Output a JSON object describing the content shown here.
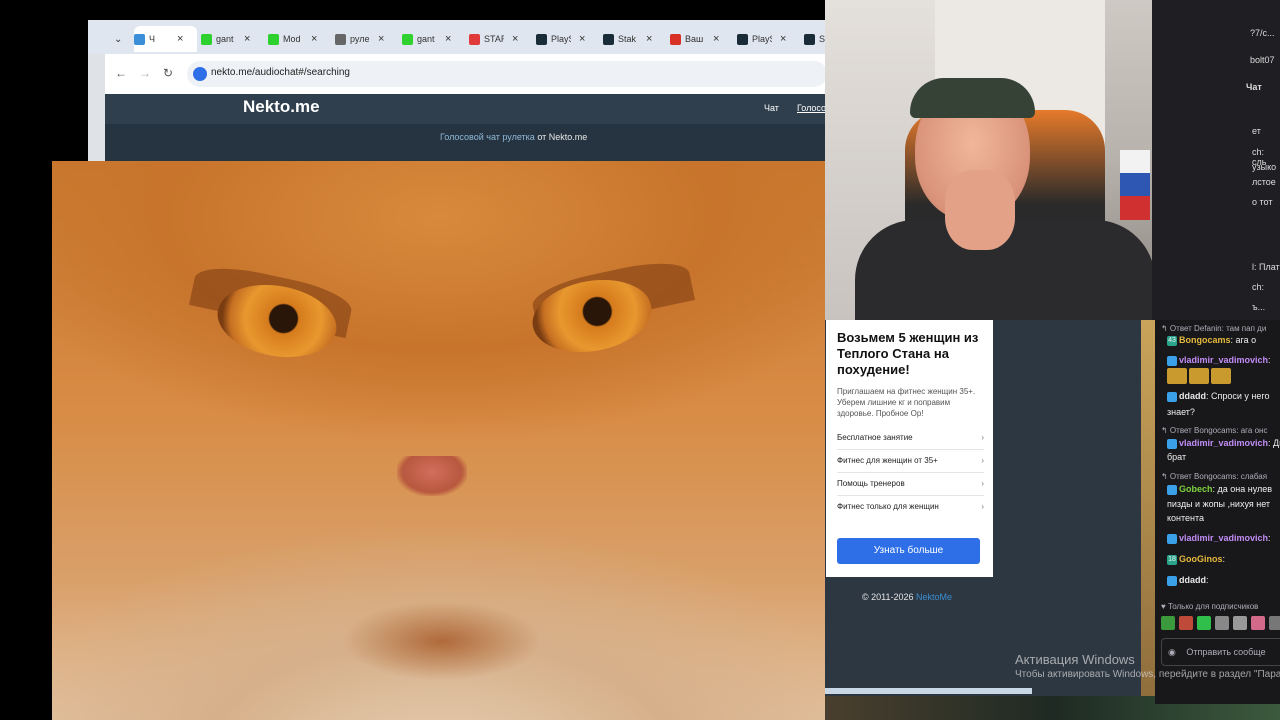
{
  "browser": {
    "tabs": [
      {
        "label": "Ч",
        "icon": "nekto-icon",
        "color": "#3a8fd8"
      },
      {
        "label": "gant",
        "icon": "kick-icon",
        "color": "#2fd12f"
      },
      {
        "label": "Mod",
        "icon": "kick-icon",
        "color": "#2fd12f"
      },
      {
        "label": "руле",
        "icon": "globe-icon",
        "color": "#666666"
      },
      {
        "label": "gant",
        "icon": "kick-icon",
        "color": "#2fd12f"
      },
      {
        "label": "STAR",
        "icon": "star-icon",
        "color": "#e03a3a"
      },
      {
        "label": "PlayS",
        "icon": "stake-icon",
        "color": "#1a2c38"
      },
      {
        "label": "Stak",
        "icon": "stake-icon",
        "color": "#1a2c38"
      },
      {
        "label": "Ваш",
        "icon": "gmail-icon",
        "color": "#d93025"
      },
      {
        "label": "PlayS",
        "icon": "stake-icon",
        "color": "#1a2c38"
      },
      {
        "label": "St",
        "icon": "stake-icon",
        "color": "#1a2c38"
      }
    ],
    "url": "nekto.me/audiochat#/searching"
  },
  "site": {
    "logo": "Nekto.me",
    "nav": [
      "Чат",
      "Голосо"
    ],
    "subtitle_link": "Голосовой чат рулетка",
    "subtitle_rest": "от Nekto.me"
  },
  "ad": {
    "title": "Возьмем 5 женщин из Теплого Стана на похудение!",
    "desc": "Приглашаем на фитнес женщин 35+. Уберем лишние кг и поправим здоровье. Пробное Ор!",
    "links": [
      "Бесплатное занятие",
      "Фитнес для женщин от 35+",
      "Помощь тренеров",
      "Фитнес только для женщин"
    ],
    "button": "Узнать больше"
  },
  "footer": {
    "copyright": "© 2011-2026",
    "brand": "NektoMe"
  },
  "right_top": {
    "lines": [
      "?7/c...",
      "bolt07",
      "Чат",
      "ет",
      "ch: сль",
      "узыко",
      "лстое",
      "о тот",
      "l: Плат",
      "ch:",
      "ъ..."
    ]
  },
  "chat": {
    "lines": [
      {
        "type": "reply",
        "text": "↰ Ответ Defanin: там пап ди"
      },
      {
        "type": "msg",
        "user": "Bongocams",
        "text": ": ага о",
        "ucls": "u2",
        "badge": "43"
      },
      {
        "type": "msg",
        "user": "vladimir_vadimovich",
        "text": ":",
        "ucls": "u1",
        "badge": ""
      },
      {
        "type": "emotes",
        "text": ""
      },
      {
        "type": "msg",
        "user": "ddadd",
        "text": ": Спроси у него",
        "ucls": "u4",
        "badge": ""
      },
      {
        "type": "text",
        "text": "знает?"
      },
      {
        "type": "reply",
        "text": "↰ Ответ Bongocams: ага онс"
      },
      {
        "type": "msg",
        "user": "vladimir_vadimovich",
        "text": ": Ди",
        "ucls": "u1",
        "badge": ""
      },
      {
        "type": "text",
        "text": "брат"
      },
      {
        "type": "reply",
        "text": "↰ Ответ Bongocams: слабая"
      },
      {
        "type": "msg",
        "user": "Gobech",
        "text": ": да она нулев",
        "ucls": "u3",
        "badge": ""
      },
      {
        "type": "text",
        "text": "пизды и жопы ,нихуя нет"
      },
      {
        "type": "text",
        "text": "контента"
      },
      {
        "type": "msg",
        "user": "vladimir_vadimovich",
        "text": ":",
        "ucls": "u1",
        "badge": ""
      },
      {
        "type": "msg",
        "user": "GooGinos",
        "text": ":",
        "ucls": "u2",
        "badge": "18"
      },
      {
        "type": "msg",
        "user": "ddadd",
        "text": ":",
        "ucls": "u4",
        "badge": ""
      },
      {
        "type": "reply",
        "text": "♥ Только для подписчиков"
      }
    ],
    "input_placeholder": "Отправить сообще"
  },
  "os": {
    "activation_title": "Активация Windows",
    "activation_text": "Чтобы активировать Windows, перейдите в раздел \"Пара"
  }
}
